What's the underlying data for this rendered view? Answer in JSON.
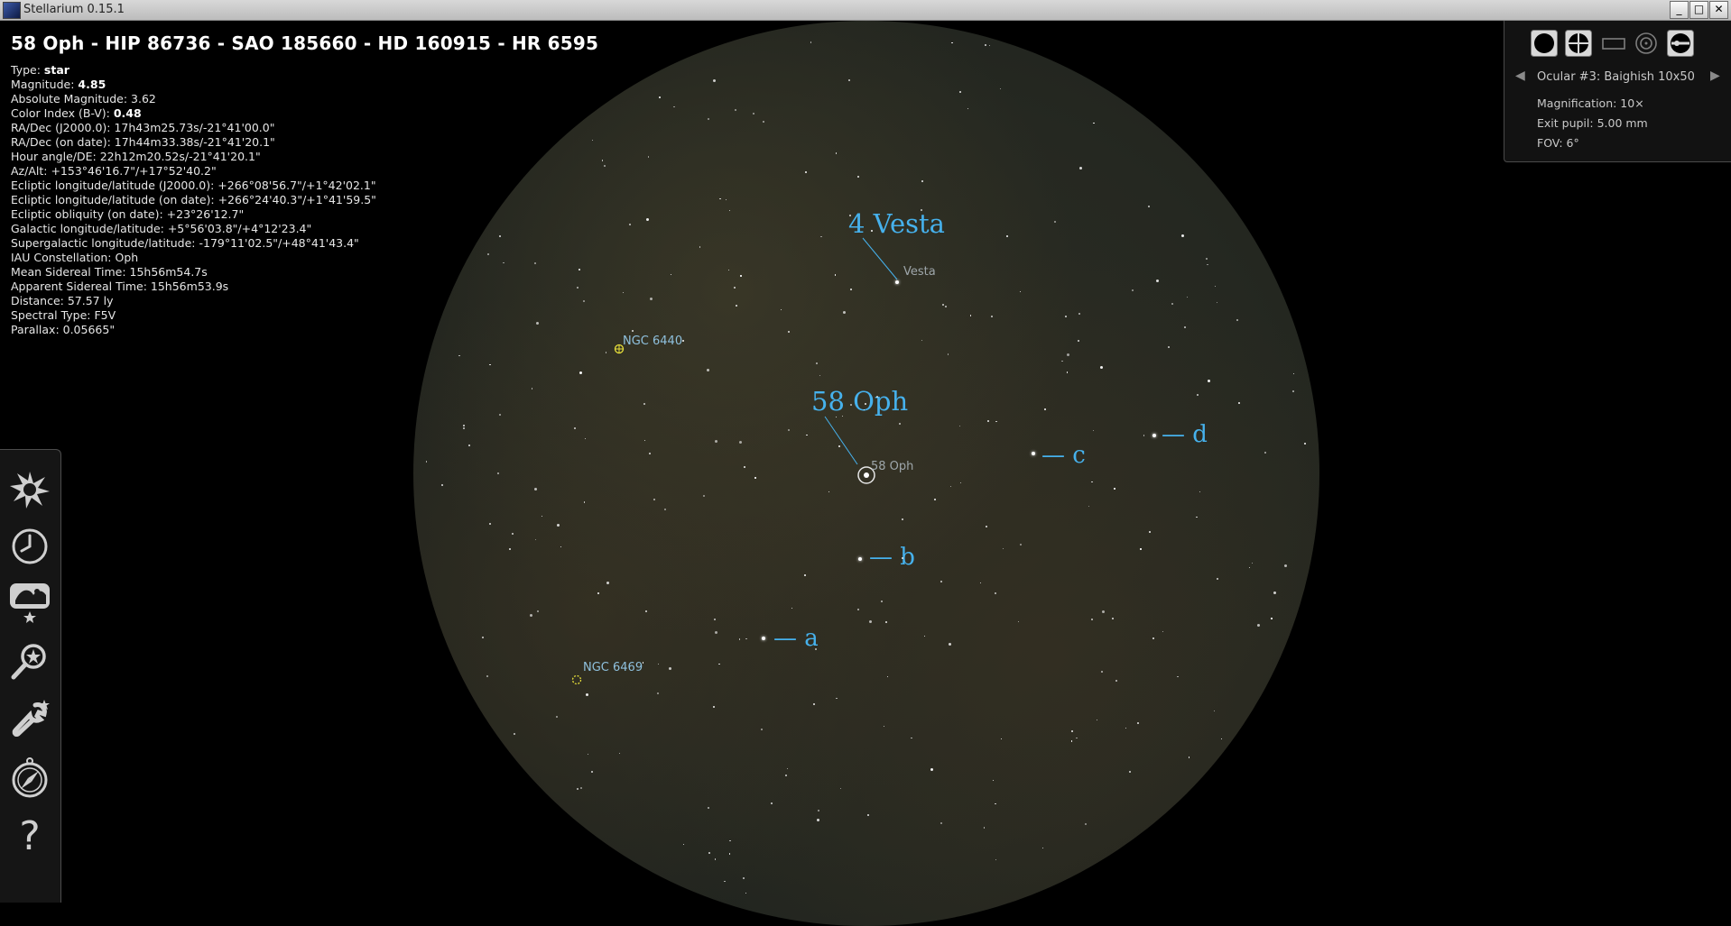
{
  "window": {
    "title": "Stellarium 0.15.1",
    "min_label": "_",
    "max_label": "□",
    "close_label": "✕"
  },
  "object": {
    "title": "58 Oph - HIP 86736 - SAO 185660 - HD 160915 - HR 6595",
    "lines": [
      {
        "label": "Type: ",
        "value": "star",
        "bold": true
      },
      {
        "label": "Magnitude: ",
        "value": "4.85",
        "bold": true
      },
      {
        "label": "Absolute Magnitude: ",
        "value": "3.62"
      },
      {
        "label": "Color Index (B-V): ",
        "value": "0.48",
        "bold": true
      },
      {
        "label": "RA/Dec (J2000.0): ",
        "value": "17h43m25.73s/-21°41'00.0\""
      },
      {
        "label": "RA/Dec (on date): ",
        "value": "17h44m33.38s/-21°41'20.1\""
      },
      {
        "label": "Hour angle/DE: ",
        "value": "22h12m20.52s/-21°41'20.1\""
      },
      {
        "label": "Az/Alt: ",
        "value": "+153°46'16.7\"/+17°52'40.2\""
      },
      {
        "label": "Ecliptic longitude/latitude (J2000.0): ",
        "value": "+266°08'56.7\"/+1°42'02.1\""
      },
      {
        "label": "Ecliptic longitude/latitude (on date): ",
        "value": "+266°24'40.3\"/+1°41'59.5\""
      },
      {
        "label": "Ecliptic obliquity (on date): ",
        "value": "+23°26'12.7\""
      },
      {
        "label": "Galactic longitude/latitude: ",
        "value": "+5°56'03.8\"/+4°12'23.4\""
      },
      {
        "label": "Supergalactic longitude/latitude: ",
        "value": "-179°11'02.5\"/+48°41'43.4\""
      },
      {
        "label": "IAU Constellation: ",
        "value": "Oph"
      },
      {
        "label": "Mean Sidereal Time: ",
        "value": "15h56m54.7s"
      },
      {
        "label": "Apparent Sidereal Time: ",
        "value": "15h56m53.9s"
      },
      {
        "label": "Distance: ",
        "value": "57.57 ly"
      },
      {
        "label": "Spectral Type: ",
        "value": "F5V"
      },
      {
        "label": "Parallax: ",
        "value": "0.05665\""
      }
    ]
  },
  "ocular": {
    "name": "Ocular #3: Baighish  10x50",
    "magnification": "Magnification: 10×",
    "exit_pupil": "Exit pupil: 5.00 mm",
    "fov": "FOV: 6°",
    "prev_label": "◀",
    "next_label": "▶"
  },
  "sky_labels": {
    "vesta_big": "4 Vesta",
    "vesta_small": "Vesta",
    "oph_big": "58 Oph",
    "oph_small": "58 Oph",
    "ngc6440": "NGC 6440",
    "ngc6469": "NGC 6469",
    "a": "— a",
    "b": "— b",
    "c": "— c",
    "d": "— d"
  },
  "toolbar": {
    "help_label": "?"
  },
  "colors": {
    "label_blue": "#46b1ec",
    "ngc_yellow": "#e8e03a"
  }
}
